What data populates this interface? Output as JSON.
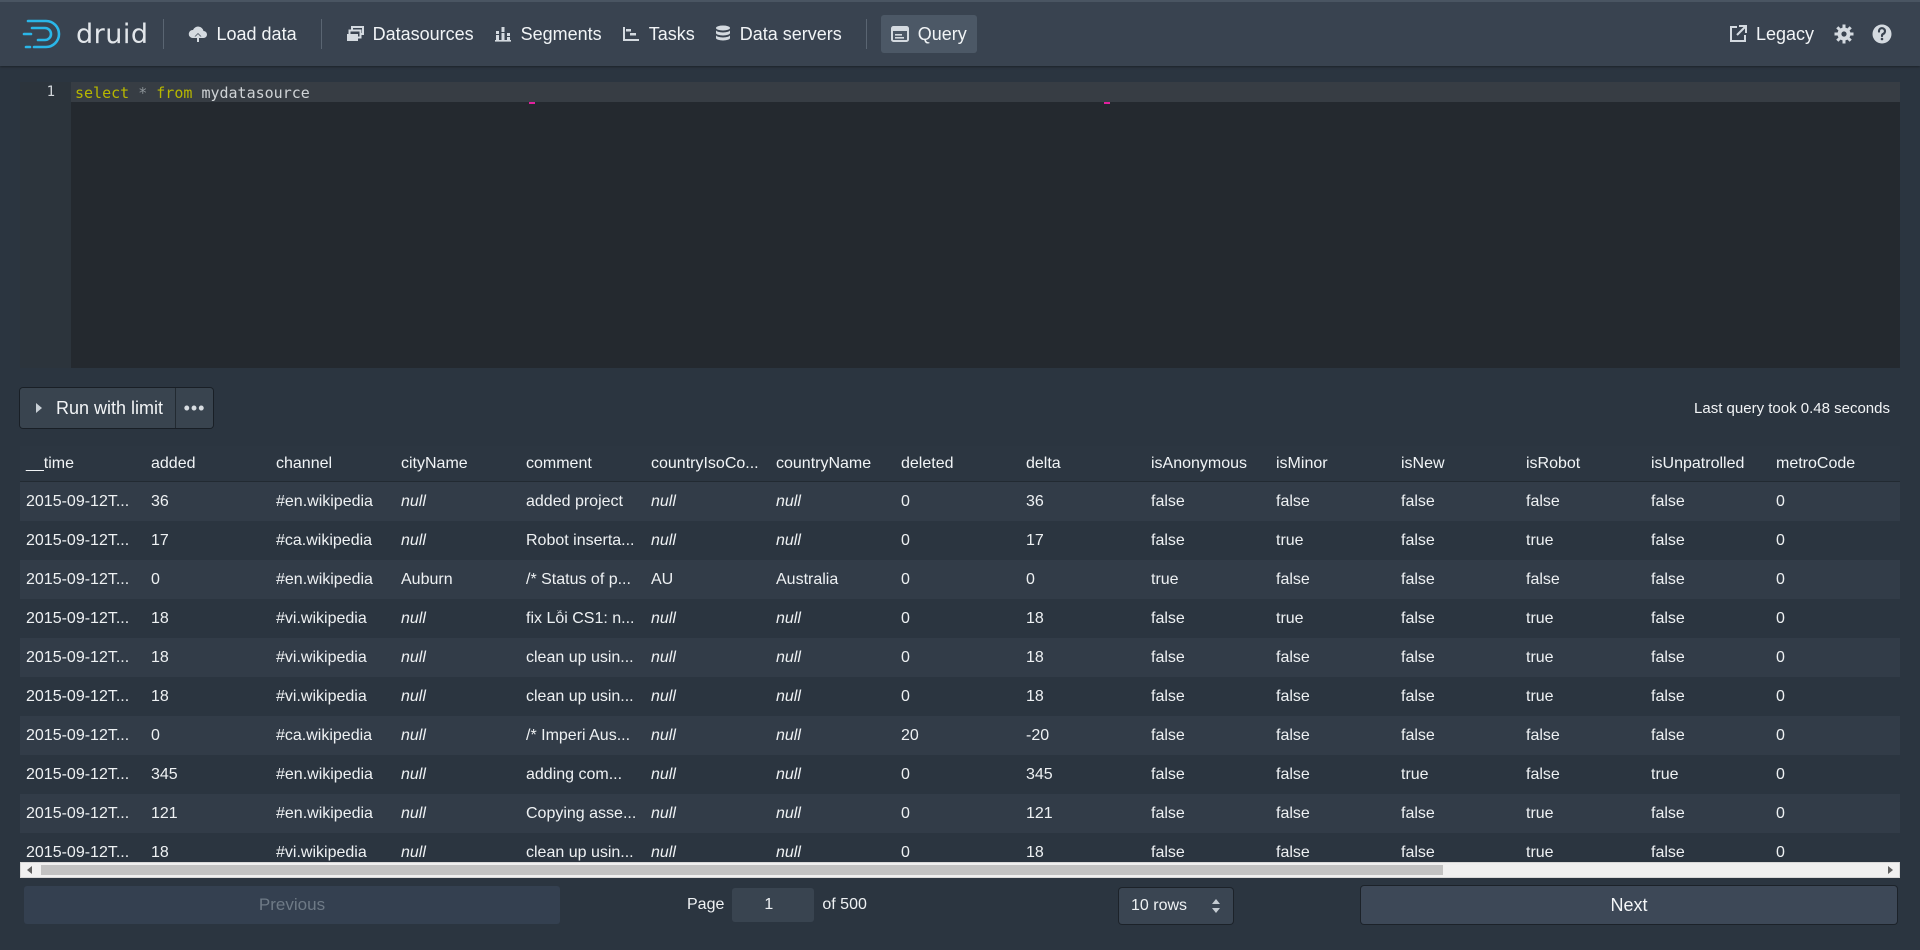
{
  "navbar": {
    "brand": "druid",
    "items": [
      {
        "label": "Load data",
        "icon": "cloud-upload-icon"
      },
      {
        "label": "Datasources",
        "icon": "multi-select-icon"
      },
      {
        "label": "Segments",
        "icon": "stacked-chart-icon"
      },
      {
        "label": "Tasks",
        "icon": "gantt-chart-icon"
      },
      {
        "label": "Data servers",
        "icon": "database-icon"
      },
      {
        "label": "Query",
        "icon": "application-icon",
        "active": true
      }
    ],
    "legacy_label": "Legacy"
  },
  "editor": {
    "line_number": "1",
    "tokens": {
      "kw1": "select",
      "op": "*",
      "kw2": "from",
      "ident": "mydatasource"
    }
  },
  "controls": {
    "run_label": "Run with limit",
    "more_label": "•••",
    "query_time": "Last query took 0.48 seconds"
  },
  "table": {
    "columns": [
      "__time",
      "added",
      "channel",
      "cityName",
      "comment",
      "countryIsoCo...",
      "countryName",
      "deleted",
      "delta",
      "isAnonymous",
      "isMinor",
      "isNew",
      "isRobot",
      "isUnpatrolled",
      "metroCode"
    ],
    "rows": [
      [
        "2015-09-12T...",
        "36",
        "#en.wikipedia",
        "null",
        "added project",
        "null",
        "null",
        "0",
        "36",
        "false",
        "false",
        "false",
        "false",
        "false",
        "0"
      ],
      [
        "2015-09-12T...",
        "17",
        "#ca.wikipedia",
        "null",
        "Robot inserta...",
        "null",
        "null",
        "0",
        "17",
        "false",
        "true",
        "false",
        "true",
        "false",
        "0"
      ],
      [
        "2015-09-12T...",
        "0",
        "#en.wikipedia",
        "Auburn",
        "/* Status of p...",
        "AU",
        "Australia",
        "0",
        "0",
        "true",
        "false",
        "false",
        "false",
        "false",
        "0"
      ],
      [
        "2015-09-12T...",
        "18",
        "#vi.wikipedia",
        "null",
        "fix Lỗi CS1: n...",
        "null",
        "null",
        "0",
        "18",
        "false",
        "true",
        "false",
        "true",
        "false",
        "0"
      ],
      [
        "2015-09-12T...",
        "18",
        "#vi.wikipedia",
        "null",
        "clean up usin...",
        "null",
        "null",
        "0",
        "18",
        "false",
        "false",
        "false",
        "true",
        "false",
        "0"
      ],
      [
        "2015-09-12T...",
        "18",
        "#vi.wikipedia",
        "null",
        "clean up usin...",
        "null",
        "null",
        "0",
        "18",
        "false",
        "false",
        "false",
        "true",
        "false",
        "0"
      ],
      [
        "2015-09-12T...",
        "0",
        "#ca.wikipedia",
        "null",
        "/* Imperi Aus...",
        "null",
        "null",
        "20",
        "-20",
        "false",
        "false",
        "false",
        "false",
        "false",
        "0"
      ],
      [
        "2015-09-12T...",
        "345",
        "#en.wikipedia",
        "null",
        "adding com...",
        "null",
        "null",
        "0",
        "345",
        "false",
        "false",
        "true",
        "false",
        "true",
        "0"
      ],
      [
        "2015-09-12T...",
        "121",
        "#en.wikipedia",
        "null",
        "Copying asse...",
        "null",
        "null",
        "0",
        "121",
        "false",
        "false",
        "false",
        "true",
        "false",
        "0"
      ],
      [
        "2015-09-12T...",
        "18",
        "#vi.wikipedia",
        "null",
        "clean up usin...",
        "null",
        "null",
        "0",
        "18",
        "false",
        "false",
        "false",
        "true",
        "false",
        "0"
      ]
    ]
  },
  "pagination": {
    "previous_label": "Previous",
    "page_label": "Page",
    "page_value": "1",
    "of_label": "of 500",
    "rows_value": "10 rows",
    "next_label": "Next"
  },
  "colors": {
    "navbar_bg": "#394350",
    "page_bg": "#2b3540",
    "editor_bg": "#24292f",
    "keyword": "#b7b700",
    "marker": "#e2209e"
  }
}
